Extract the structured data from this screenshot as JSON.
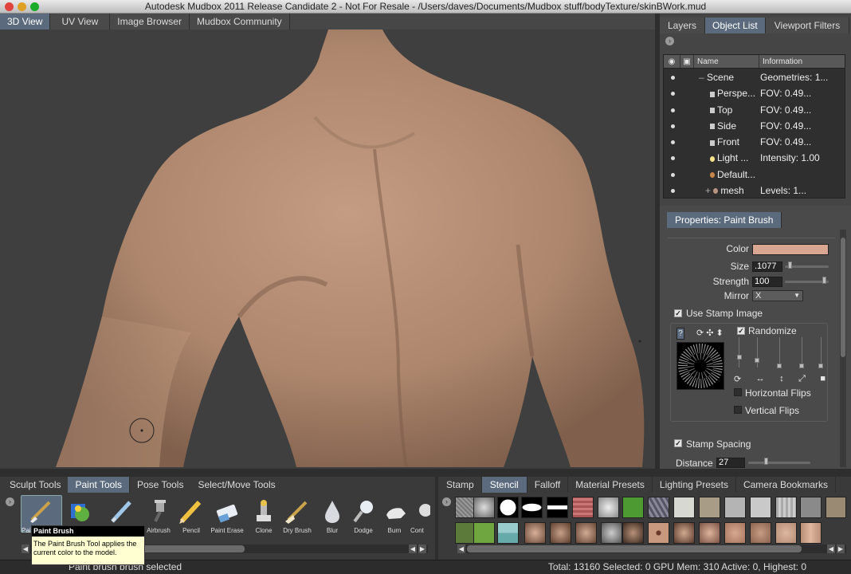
{
  "window": {
    "title": "Autodesk Mudbox 2011 Release Candidate 2 - Not For Resale - /Users/daves/Documents/Mudbox stuff/bodyTexture/skinBWork.mud"
  },
  "top_tabs": [
    "3D View",
    "UV View",
    "Image Browser",
    "Mudbox Community"
  ],
  "right_tabs": [
    "Layers",
    "Object List",
    "Viewport Filters"
  ],
  "object_list": {
    "columns": [
      "Name",
      "Information"
    ],
    "rows": [
      {
        "name": "Scene",
        "info": "Geometries: 1..."
      },
      {
        "name": "Perspe...",
        "info": "FOV: 0.49..."
      },
      {
        "name": "Top",
        "info": "FOV: 0.49..."
      },
      {
        "name": "Side",
        "info": "FOV: 0.49..."
      },
      {
        "name": "Front",
        "info": "FOV: 0.49..."
      },
      {
        "name": "Light ...",
        "info": "Intensity: 1.00"
      },
      {
        "name": "Default...",
        "info": ""
      },
      {
        "name": "mesh",
        "info": "Levels: 1..."
      }
    ]
  },
  "properties": {
    "tab": "Properties: Paint Brush",
    "color_label": "Color",
    "color_value": "#d9a791",
    "size_label": "Size",
    "size_value": ".1077",
    "strength_label": "Strength",
    "strength_value": "100",
    "mirror_label": "Mirror",
    "mirror_value": "X",
    "use_stamp_image": "Use Stamp Image",
    "randomize": "Randomize",
    "horizontal_flips": "Horizontal Flips",
    "vertical_flips": "Vertical Flips",
    "stamp_spacing": "Stamp Spacing",
    "distance_label": "Distance",
    "distance_value": "27",
    "help_glyph": "?"
  },
  "tool_tabs": [
    "Sculpt Tools",
    "Paint Tools",
    "Pose Tools",
    "Select/Move Tools"
  ],
  "paint_tools": [
    "Paint Brush",
    "Projection",
    "Airbrush",
    "Pencil",
    "Paint Erase",
    "Clone",
    "Dry Brush",
    "Blur",
    "Dodge",
    "Burn",
    "Cont"
  ],
  "paint_tools_visible_captions": [
    "",
    "",
    "Airbrush",
    "Pencil",
    "Paint Erase",
    "Clone",
    "Dry Brush",
    "Blur",
    "Dodge",
    "Burn",
    "Cont"
  ],
  "tool_caption_partial": "Pai",
  "tray_tabs": [
    "Stamp",
    "Stencil",
    "Falloff",
    "Material Presets",
    "Lighting Presets",
    "Camera Bookmarks"
  ],
  "tooltip": {
    "title": "Paint Brush",
    "body": "The Paint Brush Tool applies the current color to the model."
  },
  "status": {
    "left": "Paint brush brush selected",
    "right": "Total: 13160  Selected: 0 GPU Mem: 310  Active: 0, Highest: 0"
  },
  "colors": {
    "active_tab": "#5b6a7d",
    "skin": "#b58f76",
    "background": "#3f3f3f"
  }
}
